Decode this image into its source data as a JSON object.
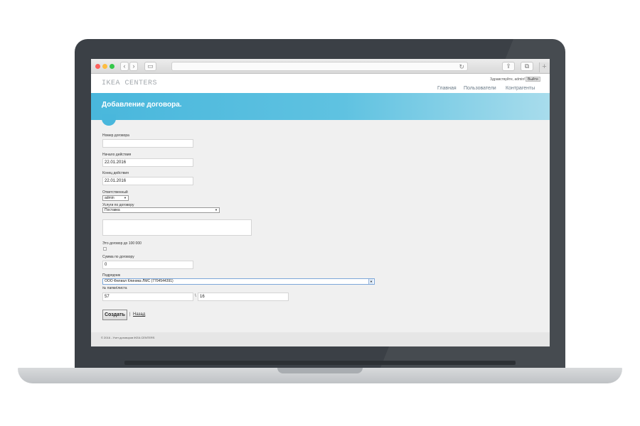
{
  "header": {
    "brand": "IKEA CENTERS",
    "greeting": "Здравствуйте, admin!",
    "logout_label": "Выйти",
    "nav": [
      "Главная",
      "Пользователи",
      "Контрагенты"
    ]
  },
  "banner": {
    "title": "Добавление договора."
  },
  "form": {
    "contract_number": {
      "label": "Номер договора",
      "value": ""
    },
    "start_date": {
      "label": "Начало действия",
      "value": "22.01.2016"
    },
    "end_date": {
      "label": "Конец действия",
      "value": "22.01.2016"
    },
    "responsible": {
      "label": "Ответственный",
      "value": "admin"
    },
    "services": {
      "label": "Услуги по договору",
      "value": "Поставка"
    },
    "under_100k": {
      "label": "Это договор до 100 000",
      "checked": false
    },
    "sum": {
      "label": "Сумма по договору",
      "value": "0"
    },
    "contractor": {
      "label": "Подрядчик",
      "value": "ООО Филиал Клиника ЛМС (7704544391)"
    },
    "folder_sheet": {
      "label": "№ папки\\листа",
      "folder": "57",
      "sheet": "16",
      "separator": "\\"
    },
    "submit_label": "Создать",
    "separator": "|",
    "back_label": "Назад"
  },
  "footer": {
    "text": "© 2016 - Учет договоров IKEA CENTERS"
  }
}
